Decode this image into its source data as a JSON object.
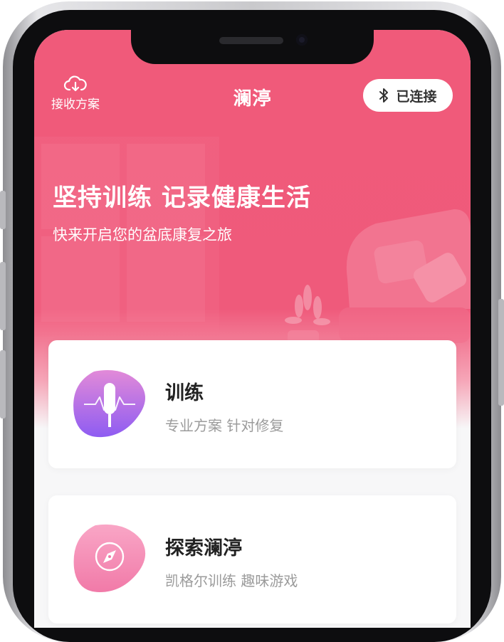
{
  "header": {
    "receive_label": "接收方案",
    "title": "澜渟",
    "connect_label": "已连接"
  },
  "hero": {
    "headline": "坚持训练  记录健康生活",
    "subline": "快来开启您的盆底康复之旅"
  },
  "cards": [
    {
      "title": "训练",
      "subtitle": "专业方案 针对修复",
      "icon": "training-probe-icon"
    },
    {
      "title": "探索澜渟",
      "subtitle": "凯格尔训练 趣味游戏",
      "icon": "compass-icon"
    }
  ],
  "colors": {
    "brand": "#ef5a7b",
    "training_gradient_start": "#e28ad8",
    "training_gradient_end": "#8e5cf2",
    "explore_gradient_start": "#f9a6c6",
    "explore_gradient_end": "#f17aa8"
  }
}
